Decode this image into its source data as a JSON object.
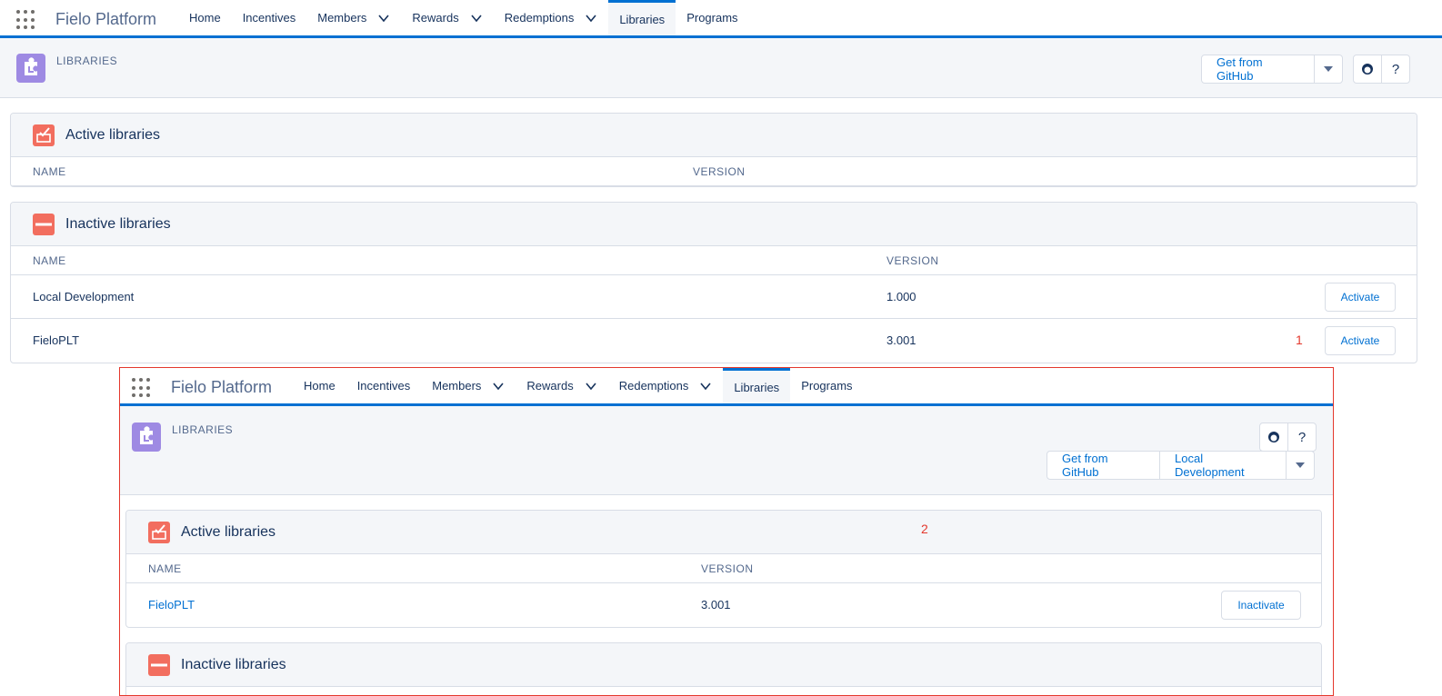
{
  "nav": {
    "app_name": "Fielo Platform",
    "tabs": [
      {
        "label": "Home"
      },
      {
        "label": "Incentives"
      },
      {
        "label": "Members"
      },
      {
        "label": "Rewards"
      },
      {
        "label": "Redemptions"
      },
      {
        "label": "Libraries"
      },
      {
        "label": "Programs"
      }
    ]
  },
  "page": {
    "title": "LIBRARIES",
    "get_from_github": "Get from GitHub",
    "local_development": "Local Development",
    "help": "?"
  },
  "top": {
    "active_title": "Active libraries",
    "inactive_title": "Inactive libraries",
    "col_name": "NAME",
    "col_version": "VERSION",
    "inactive_rows": [
      {
        "name": "Local Development",
        "version": "1.000",
        "action": "Activate"
      },
      {
        "name": "FieloPLT",
        "version": "3.001",
        "action": "Activate"
      }
    ],
    "marker": "1"
  },
  "bottom": {
    "active_title": "Active libraries",
    "inactive_title": "Inactive libraries",
    "col_name": "NAME",
    "col_version": "VERSION",
    "active_rows": [
      {
        "name": "FieloPLT",
        "version": "3.001",
        "action": "Inactivate"
      }
    ],
    "marker": "2"
  },
  "colors": {
    "accent": "#0070d2",
    "annotation": "#e4382d",
    "library_icon": "#9e8ae3",
    "card_icon": "#f26e5f"
  }
}
